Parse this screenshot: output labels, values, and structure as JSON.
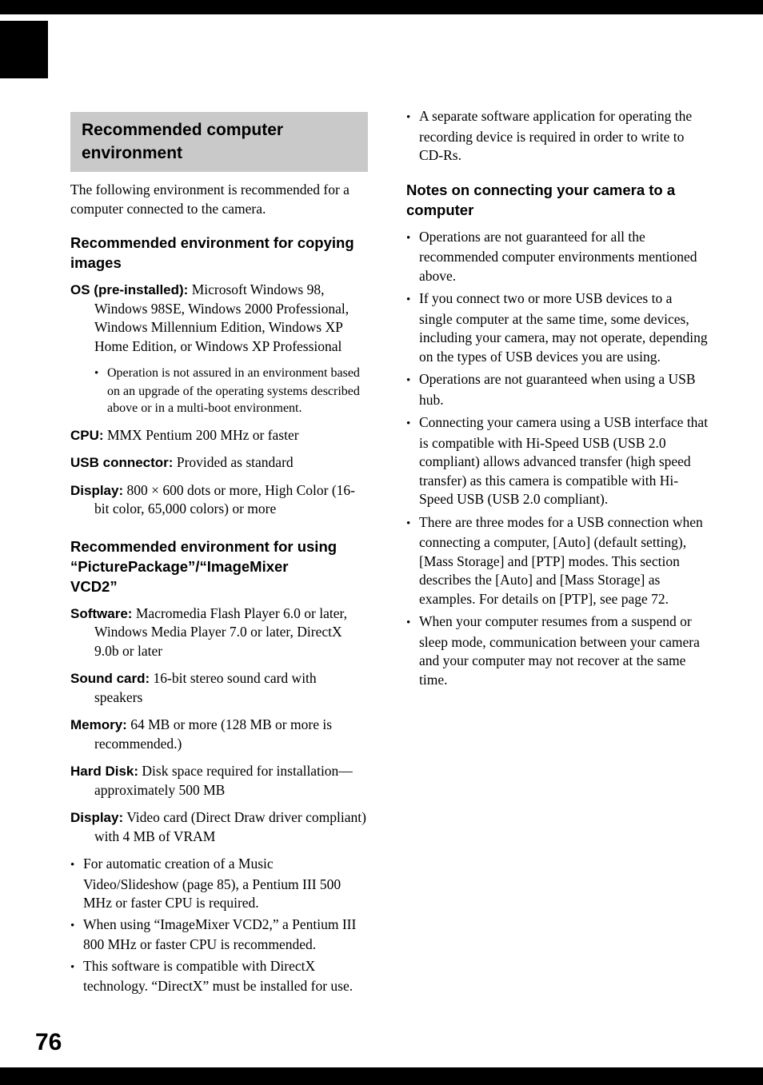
{
  "page": {
    "number": "76"
  },
  "left_column": {
    "section_heading_line1": "Recommended computer",
    "section_heading_line2": "environment",
    "intro": "The following environment is recommended for a computer connected to the camera.",
    "heading_copying": "Recommended environment for copying images",
    "specs_copying": [
      {
        "label": "OS (pre-installed):",
        "value": "Microsoft Windows 98, Windows 98SE, Windows 2000 Professional, Windows Millennium Edition, Windows XP Home Edition, or Windows XP Professional"
      },
      {
        "label": "CPU:",
        "value": "MMX Pentium 200 MHz or faster"
      },
      {
        "label": "USB connector:",
        "value": "Provided as standard"
      },
      {
        "label": "Display:",
        "value": "800 × 600 dots or more, High Color (16-bit color, 65,000 colors) or more"
      }
    ],
    "os_note": "Operation is not assured in an environment based on an upgrade of the operating systems described above or in a multi-boot environment.",
    "heading_picturepackage_line1": "Recommended environment for using",
    "heading_picturepackage_line2": "“PicturePackage”/“ImageMixer",
    "heading_picturepackage_line3": "VCD2”",
    "specs_picturepackage": [
      {
        "label": "Software:",
        "value": "Macromedia Flash Player 6.0 or later, Windows Media Player 7.0 or later, DirectX 9.0b or later"
      },
      {
        "label": "Sound card:",
        "value": "16-bit stereo sound card with speakers"
      },
      {
        "label": "Memory:",
        "value": "64 MB or more (128 MB or more is recommended.)"
      },
      {
        "label": "Hard Disk:",
        "value": "Disk space required for installation—approximately 500 MB"
      },
      {
        "label": "Display:",
        "value": "Video card (Direct Draw driver compliant) with 4 MB of VRAM"
      }
    ],
    "notes_picturepackage": [
      "For automatic creation of a Music Video/Slideshow (page 85), a Pentium III 500 MHz or faster CPU is required.",
      "When using “ImageMixer VCD2,” a Pentium III 800 MHz or faster CPU is recommended.",
      "This software is compatible with DirectX technology. “DirectX” must be installed for use."
    ]
  },
  "right_column": {
    "top_notes": [
      "A separate software application for operating the recording device is required in order to write to CD-Rs."
    ],
    "heading_notes_line1": "Notes on connecting your camera to a",
    "heading_notes_line2": "computer",
    "notes": [
      "Operations are not guaranteed for all the recommended computer environments mentioned above.",
      "If you connect two or more USB devices to a single computer at the same time, some devices, including your camera, may not operate, depending on the types of USB devices you are using.",
      "Operations are not guaranteed when using a USB hub.",
      "Connecting your camera using a USB interface that is compatible with Hi-Speed USB (USB 2.0 compliant) allows advanced transfer (high speed transfer) as this camera is compatible with Hi-Speed USB (USB 2.0 compliant).",
      "There are three modes for a USB connection when connecting a computer, [Auto] (default setting), [Mass Storage] and [PTP] modes. This section describes the [Auto] and [Mass Storage] as examples. For details on [PTP], see page 72.",
      "When your computer resumes from a suspend or sleep mode, communication between your camera and your computer may not recover at the same time."
    ]
  }
}
